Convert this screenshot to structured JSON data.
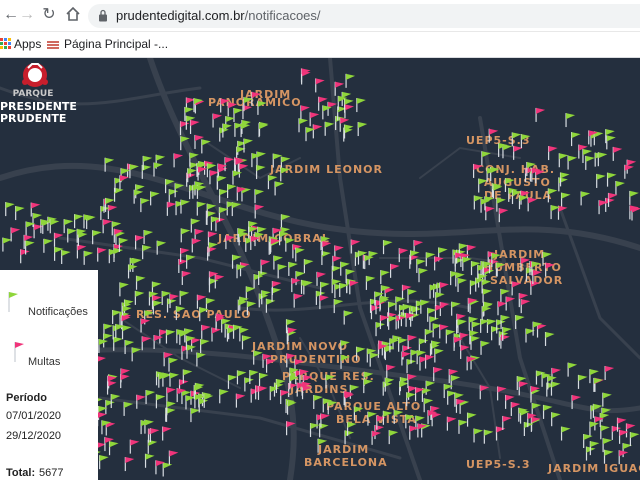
{
  "browser": {
    "url_host": "prudentedigital.com.br",
    "url_path": "/notificacoes/",
    "back_icon": "arrow-left-icon",
    "forward_icon": "arrow-right-icon",
    "reload_icon": "reload-icon",
    "home_icon": "home-icon"
  },
  "bookmarks": {
    "apps_label": "Apps",
    "page_label": "Página Principal -..."
  },
  "logo": {
    "line1": "PARQUE",
    "line2": "PRESIDENTE",
    "line3": "PRUDENTE"
  },
  "map": {
    "neighborhoods": [
      "JARDIM",
      "PANORAMICO",
      "JARDIM LEONOR",
      "UEP5-S.3",
      "CONJ. HAB.",
      "AUGUSTO",
      "DE PAULA",
      "JARDIM COBRAL",
      "JARDIM",
      "HUMBERTO",
      "SALVADOR",
      "RES. SAO PAULO",
      "JARDIM NOVO",
      "PRUDENTINO",
      "PARQUE RES.",
      "JARDINS",
      "PARQUE ALTO",
      "BELA VISTA",
      "JARDIM",
      "BARCELONA",
      "UEP5-S.3",
      "JARDIM IGUAÇU"
    ],
    "colors": {
      "background": "#242f3e",
      "road": "#38414e",
      "label": "#d59563",
      "notification": "#8fd63a",
      "fine": "#f0347a"
    }
  },
  "legend": {
    "notifications_label": "Notificações",
    "fines_label": "Multas",
    "period_title": "Período",
    "date_start": "07/01/2020",
    "date_end": "29/12/2020",
    "total_label": "Total:",
    "total_value": "5677"
  }
}
